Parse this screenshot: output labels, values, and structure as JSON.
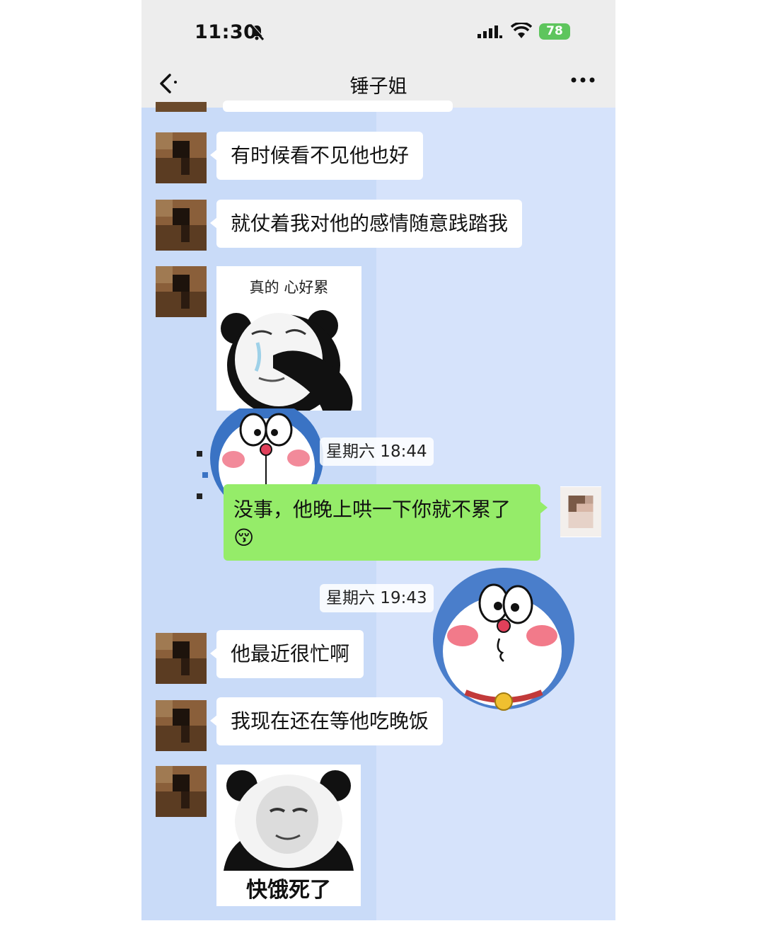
{
  "status_bar": {
    "time": "11:30",
    "battery": "78"
  },
  "nav": {
    "title": "锤子姐"
  },
  "messages": [
    {
      "text": "有时候看不见他也好"
    },
    {
      "text": "就仗着我对他的感情随意践踏我"
    },
    {
      "sticker_caption": "真的 心好累"
    },
    {
      "timestamp": "星期六 18:44"
    },
    {
      "text": "没事，他晚上哄一下你就不累了",
      "emoji": "😚"
    },
    {
      "timestamp": "星期六 19:43"
    },
    {
      "text": "他最近很忙啊"
    },
    {
      "text": "我现在还在等他吃晚饭"
    },
    {
      "sticker_caption": "快饿死了"
    }
  ]
}
